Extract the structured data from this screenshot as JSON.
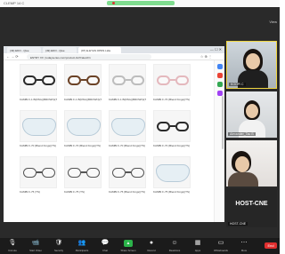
{
  "app": {
    "title": "CLEMP 14 C"
  },
  "view_button": "View",
  "browser": {
    "tabs": [
      {
        "label": "(49) EDO - Qwe"
      },
      {
        "label": "(49) EDO - Qwe"
      },
      {
        "label": "(97) E-EYAS OPDS Ltda"
      }
    ],
    "url": "ENTRY XX | todayseries.com/product-list?cateid=1",
    "window_controls": "— ☐ ✕"
  },
  "products": [
    {
      "label": "KAMBI F-1 B(RSG)(BROWN)(TS)",
      "style": "dark-frame",
      "badge": true
    },
    {
      "label": "KAMBI F-1 B(RSG)(BROWN)(TS)",
      "style": "brown-frame",
      "badge": true
    },
    {
      "label": "KAMBI F-1 B(RSG)(BROWN)(TS)",
      "style": "clear-frame",
      "badge": true
    },
    {
      "label": "KAMBI F-70 (Blend Kings)(TS)",
      "style": "pink-frame",
      "badge": false
    },
    {
      "label": "KAMBI F-70 (Blend Kings)(TS)",
      "style": "shield",
      "badge": false
    },
    {
      "label": "KAMBI F-70 (Blend Kings)(TS)",
      "style": "shield",
      "badge": false
    },
    {
      "label": "KAMBI F-70 (Blend Kings)(TS)",
      "style": "shield",
      "badge": false
    },
    {
      "label": "KAMBI F-70 (Blend Kings)(TS)",
      "style": "dark-frame",
      "badge": false
    },
    {
      "label": "KAMBI F-75 (TS)",
      "style": "thin-frame",
      "badge": false
    },
    {
      "label": "KAMBI F-75 (TS)",
      "style": "thin-frame",
      "badge": false
    },
    {
      "label": "KAMBI F-75 (Blend Kings)(TS)",
      "style": "thin-frame",
      "badge": false
    },
    {
      "label": "KAMBI F-75 (Blend Kings)(TS)",
      "style": "shield",
      "badge": false
    }
  ],
  "participants": [
    {
      "name": "KOOPI C",
      "speaking": true
    },
    {
      "name": "Alexander_Tao B",
      "speaking": false
    },
    {
      "name": "",
      "speaking": false
    }
  ],
  "host": {
    "big_label": "HOST-CNE",
    "small_label": "HOST-CNE"
  },
  "toolbar": {
    "items": [
      {
        "icon": "microphone-icon",
        "glyph": "🎙",
        "label": "Unmute"
      },
      {
        "icon": "video-icon",
        "glyph": "📹",
        "label": "Start Video"
      },
      {
        "icon": "security-icon",
        "glyph": "🛡",
        "label": "Security"
      },
      {
        "icon": "participants-icon",
        "glyph": "👥",
        "label": "Participants"
      },
      {
        "icon": "chat-icon",
        "glyph": "💬",
        "label": "Chat"
      },
      {
        "icon": "share-screen-icon",
        "glyph": "▲",
        "label": "Share Screen"
      },
      {
        "icon": "record-icon",
        "glyph": "●",
        "label": "Record"
      },
      {
        "icon": "reactions-icon",
        "glyph": "☺",
        "label": "Reactions"
      },
      {
        "icon": "apps-icon",
        "glyph": "▦",
        "label": "Apps"
      },
      {
        "icon": "whiteboard-icon",
        "glyph": "▭",
        "label": "Whiteboards"
      },
      {
        "icon": "more-icon",
        "glyph": "⋯",
        "label": "More"
      }
    ],
    "end_label": "End"
  },
  "colors": {
    "speaking_border": "#f0d640",
    "end_button": "#e02f2f",
    "share_button": "#2bb34a",
    "badge": "#e53935"
  }
}
